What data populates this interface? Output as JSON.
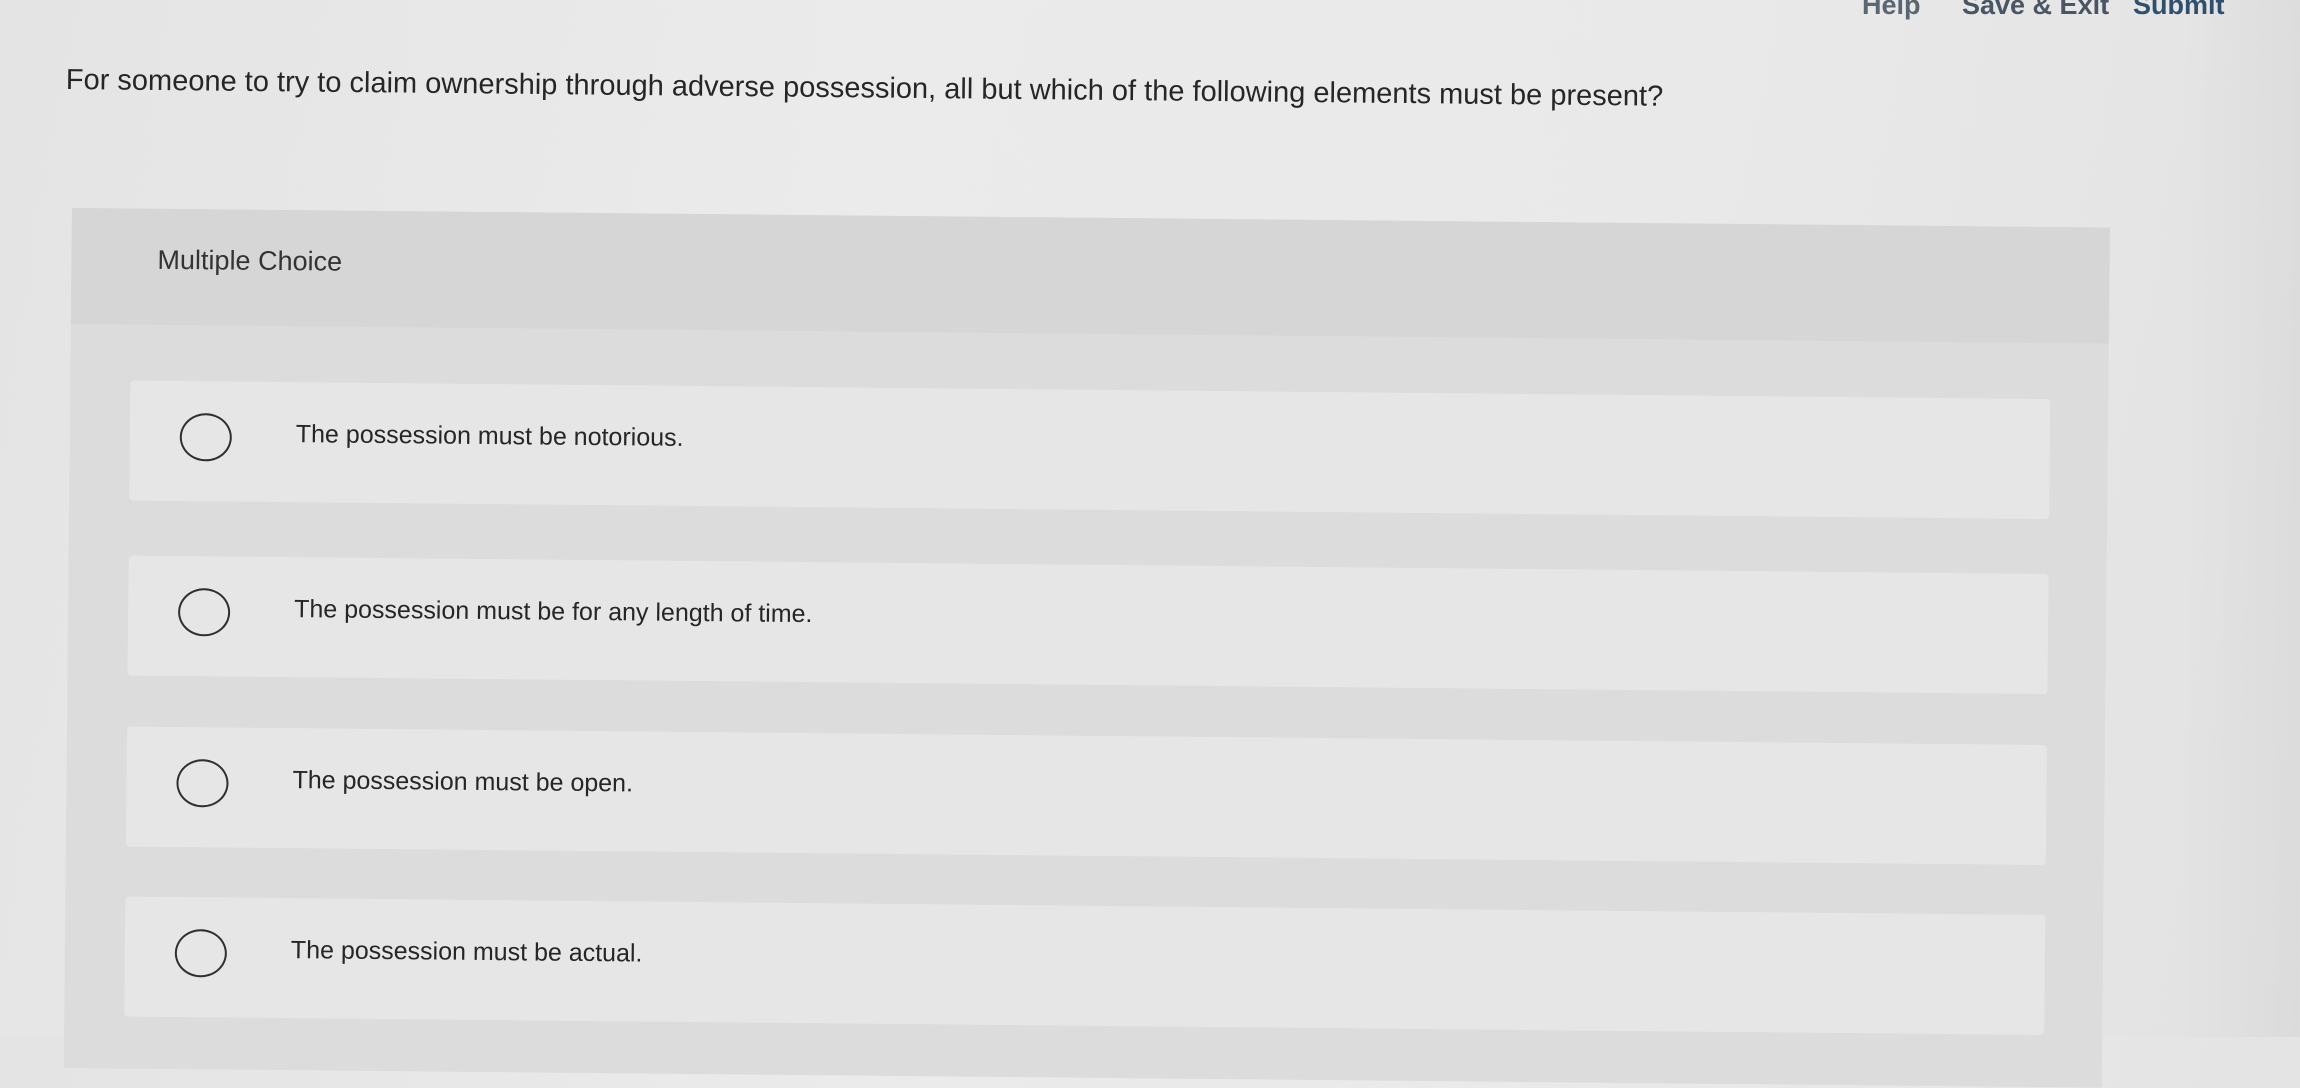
{
  "nav": {
    "help_label": "Help",
    "save_exit_label": "Save & Exit",
    "submit_label": "Submit"
  },
  "question": {
    "text": "For someone to try to claim ownership through adverse possession, all but which of the following elements must be present?"
  },
  "multiple_choice": {
    "label": "Multiple Choice",
    "choices": [
      {
        "label": "The possession must be notorious.",
        "selected": false
      },
      {
        "label": "The possession must be for any length of time.",
        "selected": false
      },
      {
        "label": "The possession must be open.",
        "selected": false
      },
      {
        "label": "The possession must be actual.",
        "selected": false
      }
    ]
  }
}
